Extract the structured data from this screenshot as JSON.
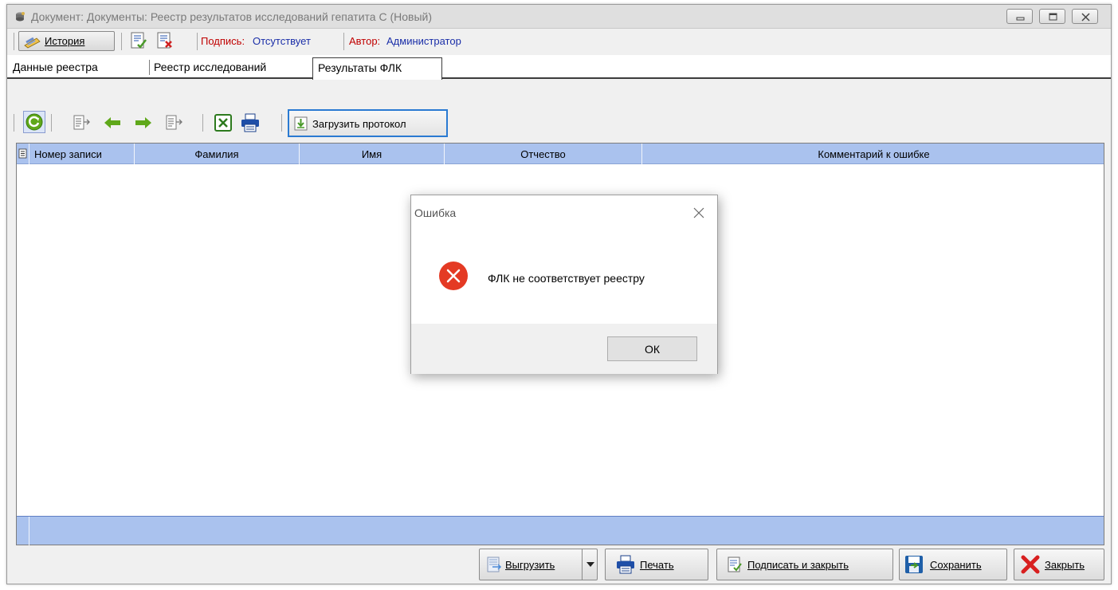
{
  "window": {
    "title": "Документ: Документы: Реестр результатов исследований гепатита С (Новый)"
  },
  "toolbar1": {
    "history_label": "История",
    "signature_label": "Подпись:",
    "signature_value": "Отсутствует",
    "author_label": "Автор:",
    "author_value": "Администратор"
  },
  "tabs": [
    {
      "label": "Данные реестра",
      "active": false
    },
    {
      "label": "Реестр исследований",
      "active": false
    },
    {
      "label": "Результаты ФЛК",
      "active": true
    }
  ],
  "toolbar2": {
    "load_protocol_label": "Загрузить протокол"
  },
  "grid": {
    "columns": [
      "Номер записи",
      "Фамилия",
      "Имя",
      "Отчество",
      "Комментарий к ошибке"
    ],
    "rows": []
  },
  "buttons": {
    "export": "Выгрузить",
    "print": "Печать",
    "sign_and_close": "Подписать и закрыть",
    "save": "Сохранить",
    "close": "Закрыть"
  },
  "dialog": {
    "title": "Ошибка",
    "message": "ФЛК не соответствует реестру",
    "ok_label": "ОК"
  },
  "colors": {
    "grid_header": "#aac2ee",
    "error_red": "#e43a24",
    "accent_green": "#5fa81a",
    "focus_blue": "#2a7ad2"
  }
}
